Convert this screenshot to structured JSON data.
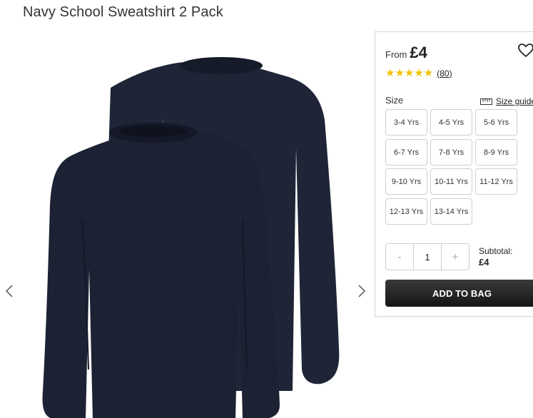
{
  "product": {
    "title": "Navy School Sweatshirt 2 Pack",
    "image_icon": "navy-sweatshirt-2-pack-image"
  },
  "gallery": {
    "prev_icon": "chevron-left-icon",
    "next_icon": "chevron-right-icon"
  },
  "purchase": {
    "from_label": "From",
    "price": "£4",
    "wishlist_icon": "heart-icon",
    "rating_stars": 5,
    "review_count": "(80)",
    "size_label": "Size",
    "size_guide_label": "Size guide",
    "size_guide_icon": "ruler-icon",
    "sizes": [
      "3-4 Yrs",
      "4-5 Yrs",
      "5-6 Yrs",
      "6-7 Yrs",
      "7-8 Yrs",
      "8-9 Yrs",
      "9-10 Yrs",
      "10-11 Yrs",
      "11-12 Yrs",
      "12-13 Yrs",
      "13-14 Yrs"
    ],
    "quantity": {
      "minus": "-",
      "value": "1",
      "plus": "+"
    },
    "subtotal_label": "Subtotal:",
    "subtotal_value": "£4",
    "add_to_bag_label": "ADD TO BAG"
  },
  "colors": {
    "star": "#f2c200",
    "sweatshirt": "#1c2233",
    "button": "#1e1e1e"
  }
}
